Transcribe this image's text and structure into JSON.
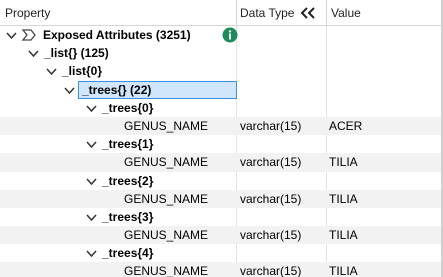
{
  "header": {
    "property_label": "Property",
    "data_type_label": "Data Type",
    "value_label": "Value",
    "collapse_icon": "double-chevron-left-icon"
  },
  "tree": {
    "root": {
      "label": "Exposed Attributes (3251)",
      "icon": "feature-type-icon",
      "info_icon": "info-icon"
    },
    "list": {
      "label": "_list{} (125)"
    },
    "list0": {
      "label": "_list{0}"
    },
    "trees": {
      "label": "_trees{} (22)"
    },
    "items": [
      {
        "label": "_trees{0}",
        "attr_name": "GENUS_NAME",
        "attr_type": "varchar(15)",
        "attr_value": "ACER"
      },
      {
        "label": "_trees{1}",
        "attr_name": "GENUS_NAME",
        "attr_type": "varchar(15)",
        "attr_value": "TILIA"
      },
      {
        "label": "_trees{2}",
        "attr_name": "GENUS_NAME",
        "attr_type": "varchar(15)",
        "attr_value": "TILIA"
      },
      {
        "label": "_trees{3}",
        "attr_name": "GENUS_NAME",
        "attr_type": "varchar(15)",
        "attr_value": "TILIA"
      },
      {
        "label": "_trees{4}",
        "attr_name": "GENUS_NAME",
        "attr_type": "varchar(15)",
        "attr_value": "TILIA"
      }
    ]
  },
  "colors": {
    "selection_border": "#3d8ede",
    "selection_fill": "#cfe6fb",
    "info_icon": "#1f8a5a",
    "attribute_row": "#f2f2f2"
  }
}
